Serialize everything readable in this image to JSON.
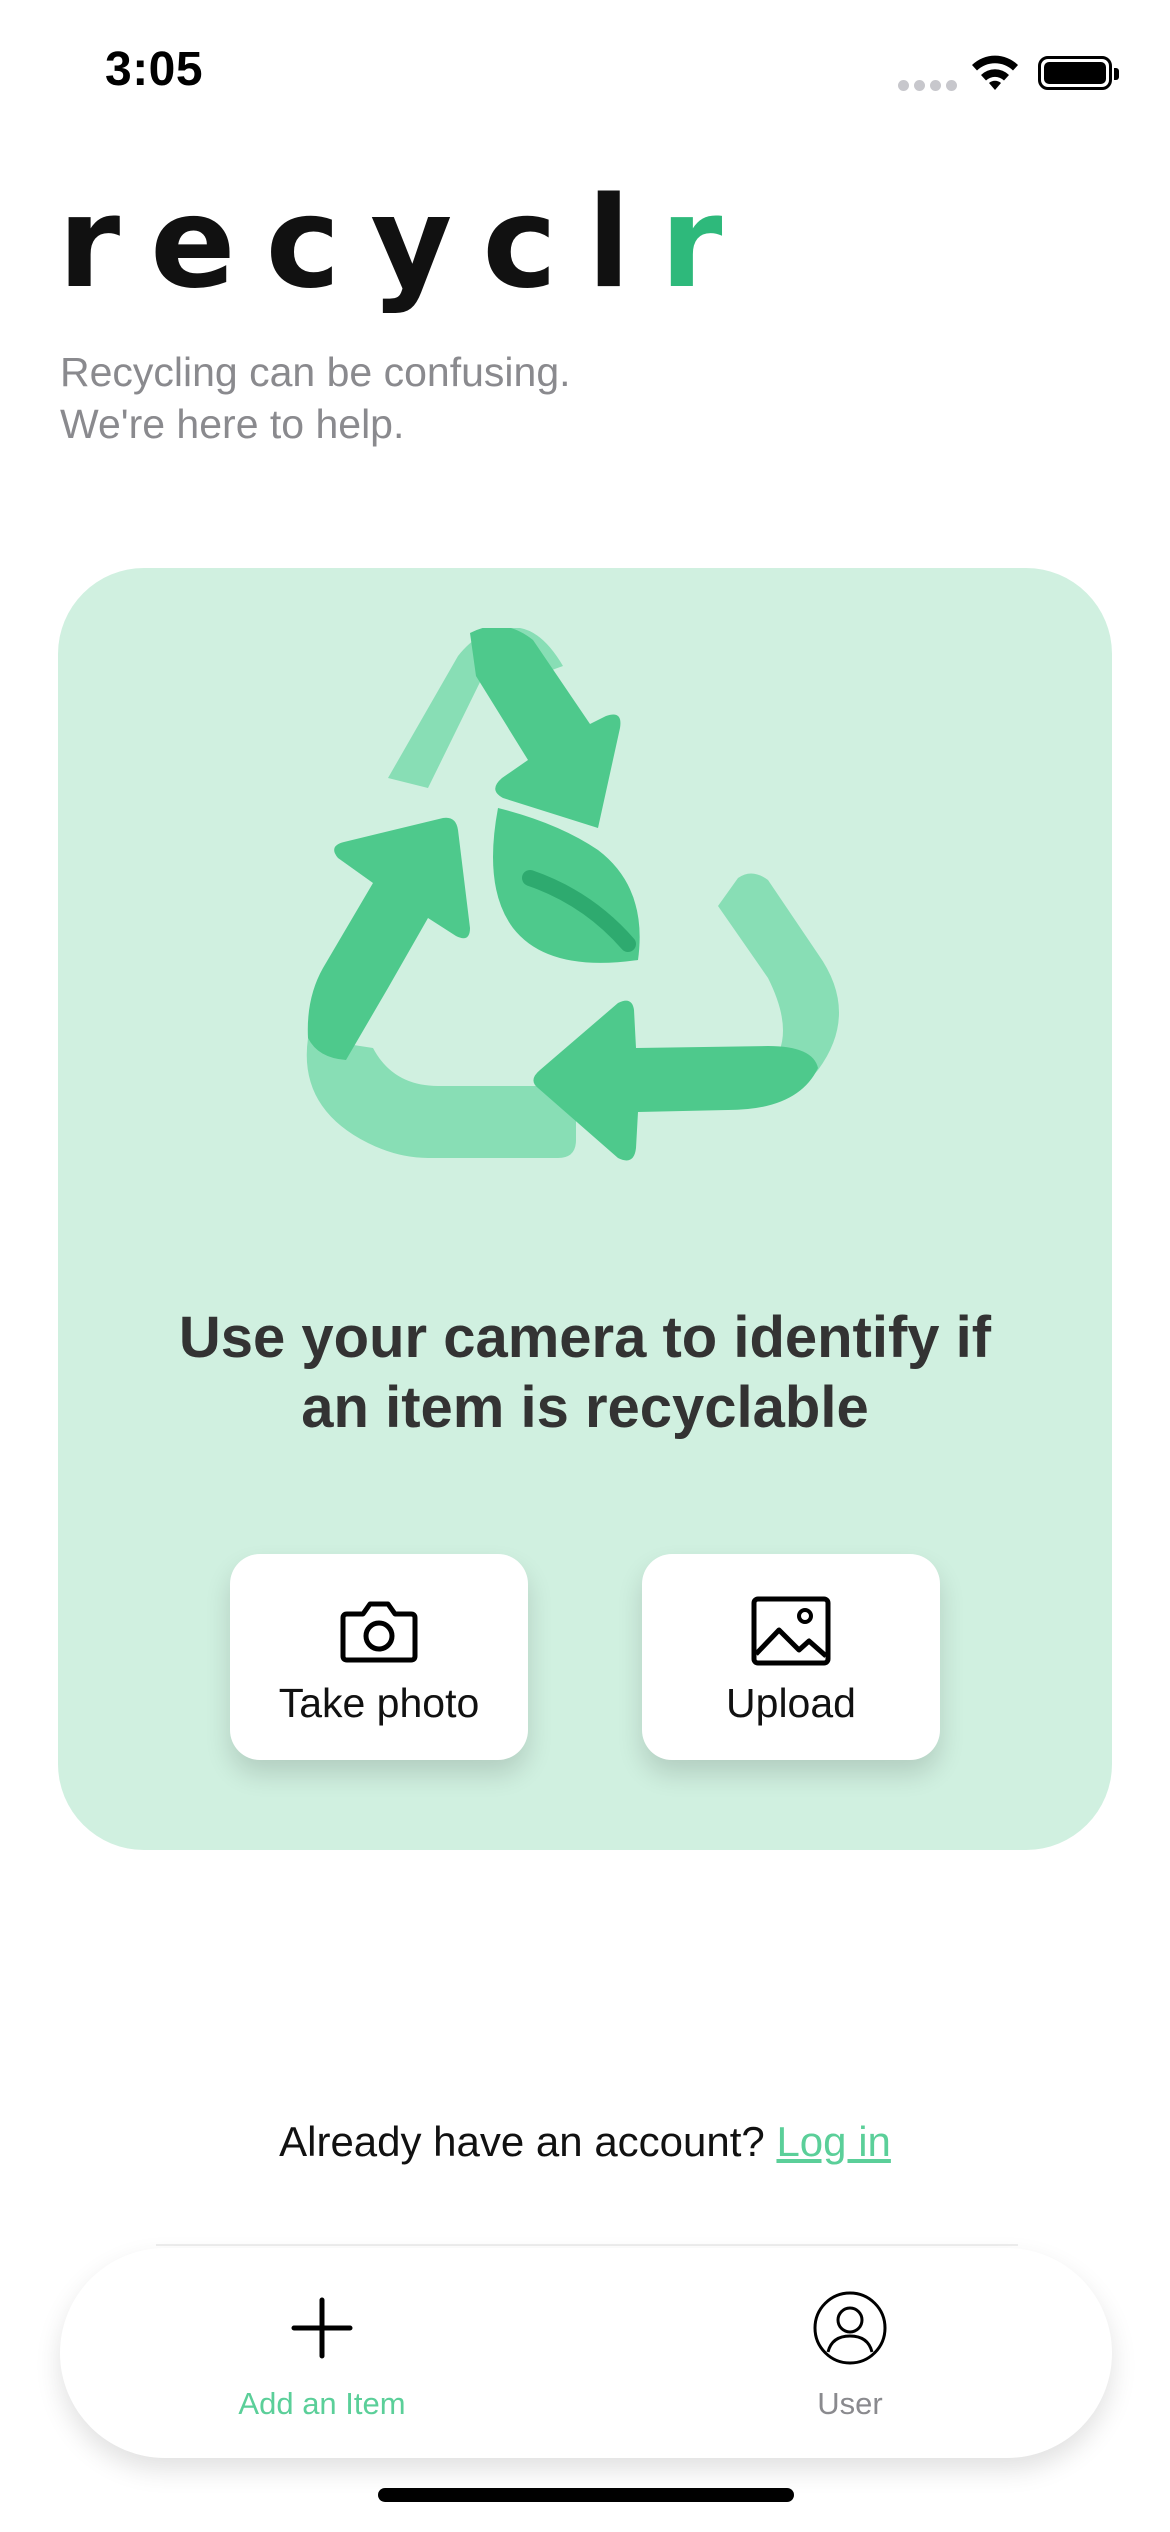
{
  "status_bar": {
    "time": "3:05",
    "signal_icon": "cellular-signal-icon",
    "wifi_icon": "wifi-icon",
    "battery_icon": "battery-icon"
  },
  "brand": {
    "logo_main": "recycl",
    "logo_accent": "r",
    "tagline_line1": "Recycling can be confusing.",
    "tagline_line2": "We're here to help."
  },
  "card": {
    "illustration_icon": "recycle-leaf-icon",
    "headline_line1": "Use your camera to identify if",
    "headline_line2": "an item is recyclable",
    "actions": [
      {
        "icon": "camera-icon",
        "label": "Take photo"
      },
      {
        "icon": "image-icon",
        "label": "Upload"
      }
    ]
  },
  "account": {
    "prompt": "Already have an account?",
    "link": "Log in"
  },
  "tab_bar": {
    "items": [
      {
        "icon": "plus-icon",
        "label": "Add an Item",
        "active": true
      },
      {
        "icon": "user-icon",
        "label": "User",
        "active": false
      }
    ]
  },
  "colors": {
    "accent": "#2eb97b",
    "card_background": "#d0f0e0",
    "link": "#5bcf99",
    "secondary_text": "#8a8a8e"
  }
}
